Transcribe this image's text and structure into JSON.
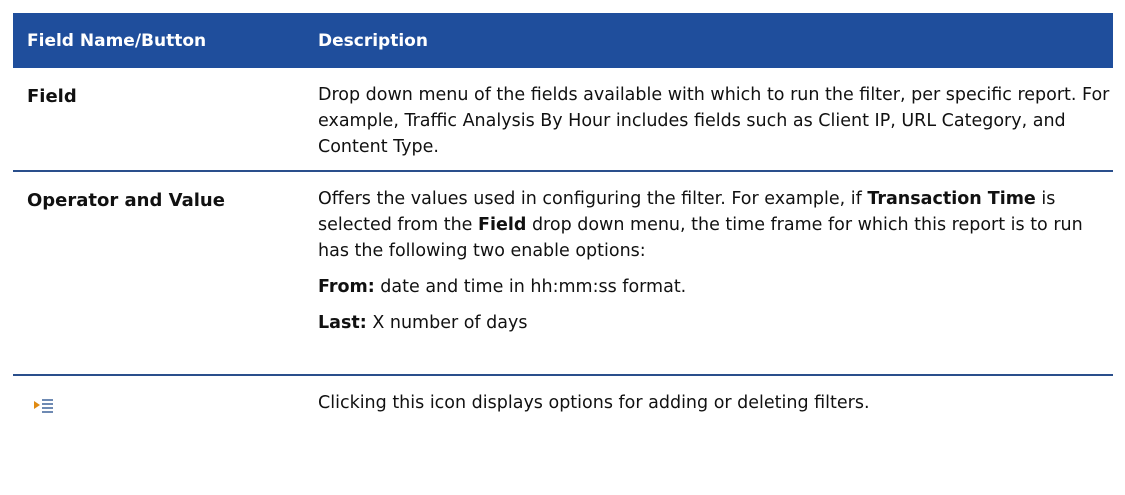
{
  "table": {
    "headers": {
      "col1": "Field Name/Button",
      "col2": "Description"
    },
    "rows": [
      {
        "name": "Field",
        "description": "Drop down menu of the fields available with which to run the filter, per specific report. For example, Traffic Analysis By Hour includes fields such as Client IP, URL Category, and Content Type."
      },
      {
        "name": "Operator and Value",
        "desc_part1": "Offers the values used in configuring the filter. For example, if ",
        "desc_bold1": "Transaction Time",
        "desc_part2": " is selected from the ",
        "desc_bold2": "Field",
        "desc_part3": " drop down menu, the time frame for which this report is to run has the following two enable options:",
        "from_label": "From:",
        "from_text": " date and time in hh:mm:ss format.",
        "last_label": "Last:",
        "last_text": " X number of days"
      },
      {
        "icon": "filter-options-icon",
        "description": "Clicking this icon displays options for adding or deleting filters."
      }
    ]
  },
  "colors": {
    "header_bg": "#1f4e9c",
    "divider": "#2a4f8c"
  }
}
